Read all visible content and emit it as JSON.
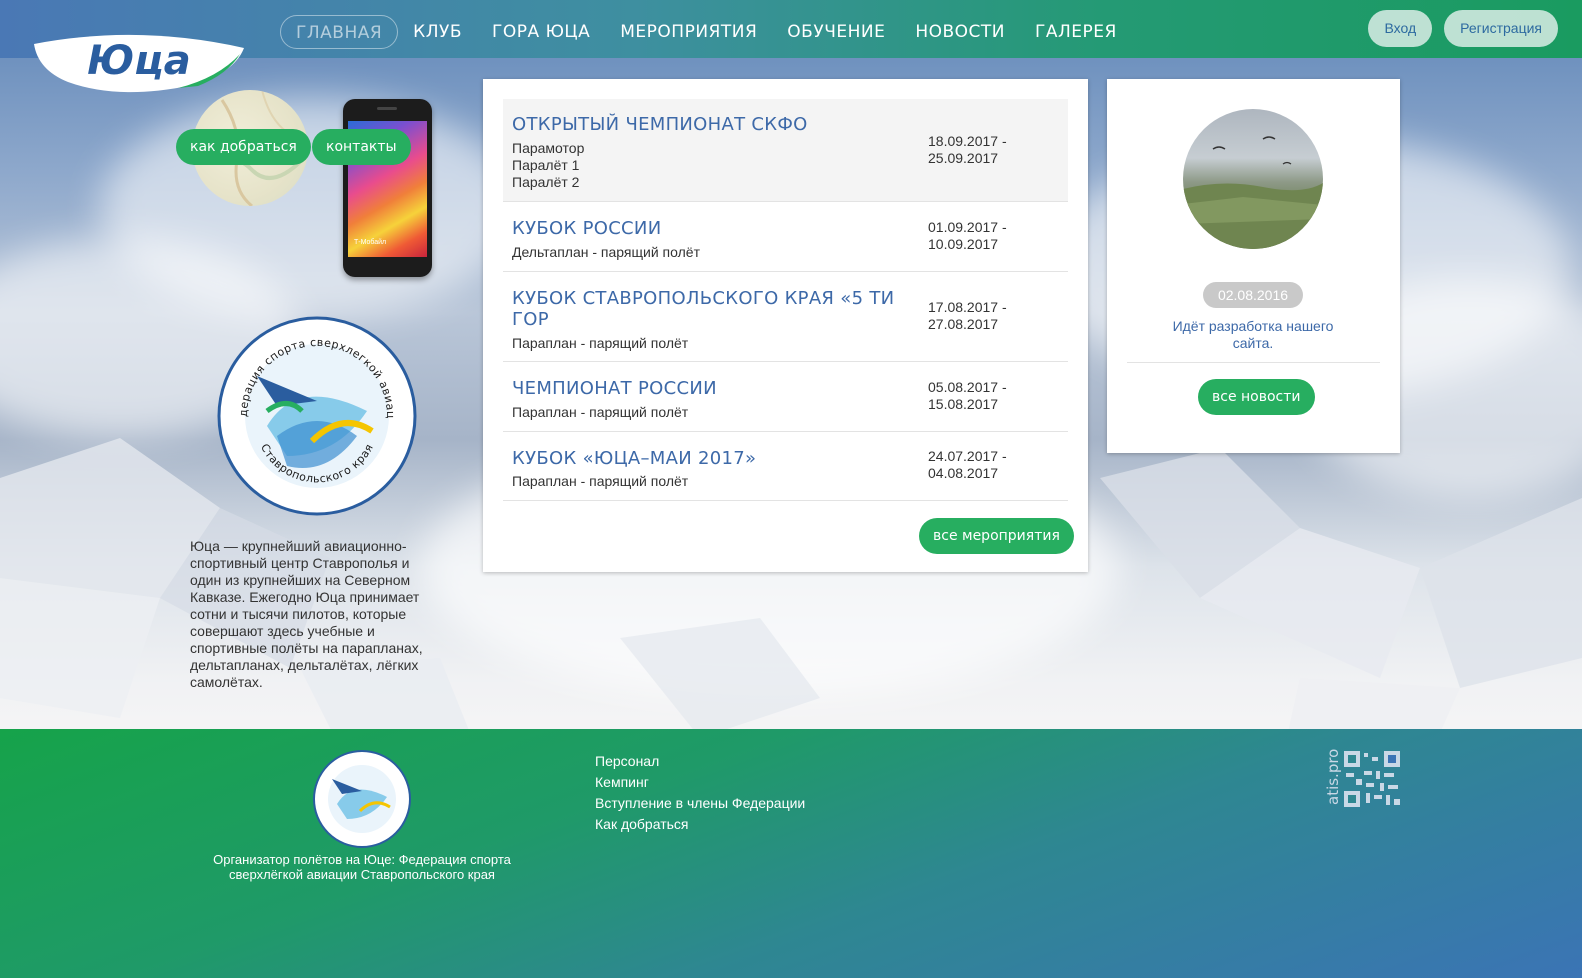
{
  "header": {
    "logo_text": "Юца",
    "nav": [
      {
        "label": "ГЛАВНАЯ",
        "active": true
      },
      {
        "label": "КЛУБ"
      },
      {
        "label": "ГОРА ЮЦА"
      },
      {
        "label": "МЕРОПРИЯТИЯ"
      },
      {
        "label": "ОБУЧЕНИЕ"
      },
      {
        "label": "НОВОСТИ"
      },
      {
        "label": "ГАЛЕРЕЯ"
      }
    ],
    "login_label": "Вход",
    "register_label": "Регистрация"
  },
  "left": {
    "directions_label": "как добраться",
    "contacts_label": "контакты",
    "phone_screen_text": "Т-Мобайл",
    "federation_logo": {
      "top_text": "Федерация спорта сверхлегкой авиации",
      "bottom_text": "Ставропольского края"
    },
    "about": "Юца — крупнейший авиационно-спортивный центр Ставрополья и один из крупнейших на Северном Кавказе. Ежегодно Юца принимает сотни и тысячи пилотов, которые совершают здесь учебные и спортивные полёты на парапланах, дельтапланах, дельталётах, лёгких самолётах."
  },
  "events": {
    "items": [
      {
        "title": "ОТКРЫТЫЙ ЧЕМПИОНАТ СКФО",
        "subtitles": [
          "Парамотор",
          "Паралёт 1",
          "Паралёт 2"
        ],
        "date_from": "18.09.2017 -",
        "date_to": "25.09.2017"
      },
      {
        "title": "КУБОК РОССИИ",
        "subtitles": [
          "Дельтаплан - парящий полёт"
        ],
        "date_from": "01.09.2017 -",
        "date_to": "10.09.2017"
      },
      {
        "title": "КУБОК СТАВРОПОЛЬСКОГО КРАЯ «5 ТИ ГОР",
        "subtitles": [
          "Параплан - парящий полёт"
        ],
        "date_from": "17.08.2017 -",
        "date_to": "27.08.2017"
      },
      {
        "title": "ЧЕМПИОНАТ РОССИИ",
        "subtitles": [
          "Параплан - парящий полёт"
        ],
        "date_from": "05.08.2017 -",
        "date_to": "15.08.2017"
      },
      {
        "title": "КУБОК «ЮЦА–МАИ 2017»",
        "subtitles": [
          "Параплан - парящий полёт"
        ],
        "date_from": "24.07.2017 -",
        "date_to": "04.08.2017"
      }
    ],
    "all_label": "все мероприятия"
  },
  "news": {
    "date": "02.08.2016",
    "text": "Идёт разработка нашего сайта.",
    "all_label": "все новости"
  },
  "footer": {
    "org_text": "Организатор полётов на Юце: Федерация спорта сверхлёгкой авиации Ставропольского края",
    "links": [
      "Персонал",
      "Кемпинг",
      "Вступление в члены Федерации",
      "Как добраться"
    ],
    "atis_label": "atis.pro"
  },
  "colors": {
    "green": "#27ae60",
    "blue_text": "#3d69a8",
    "header_left": "#4a78b5",
    "header_right": "#1a9b60"
  }
}
